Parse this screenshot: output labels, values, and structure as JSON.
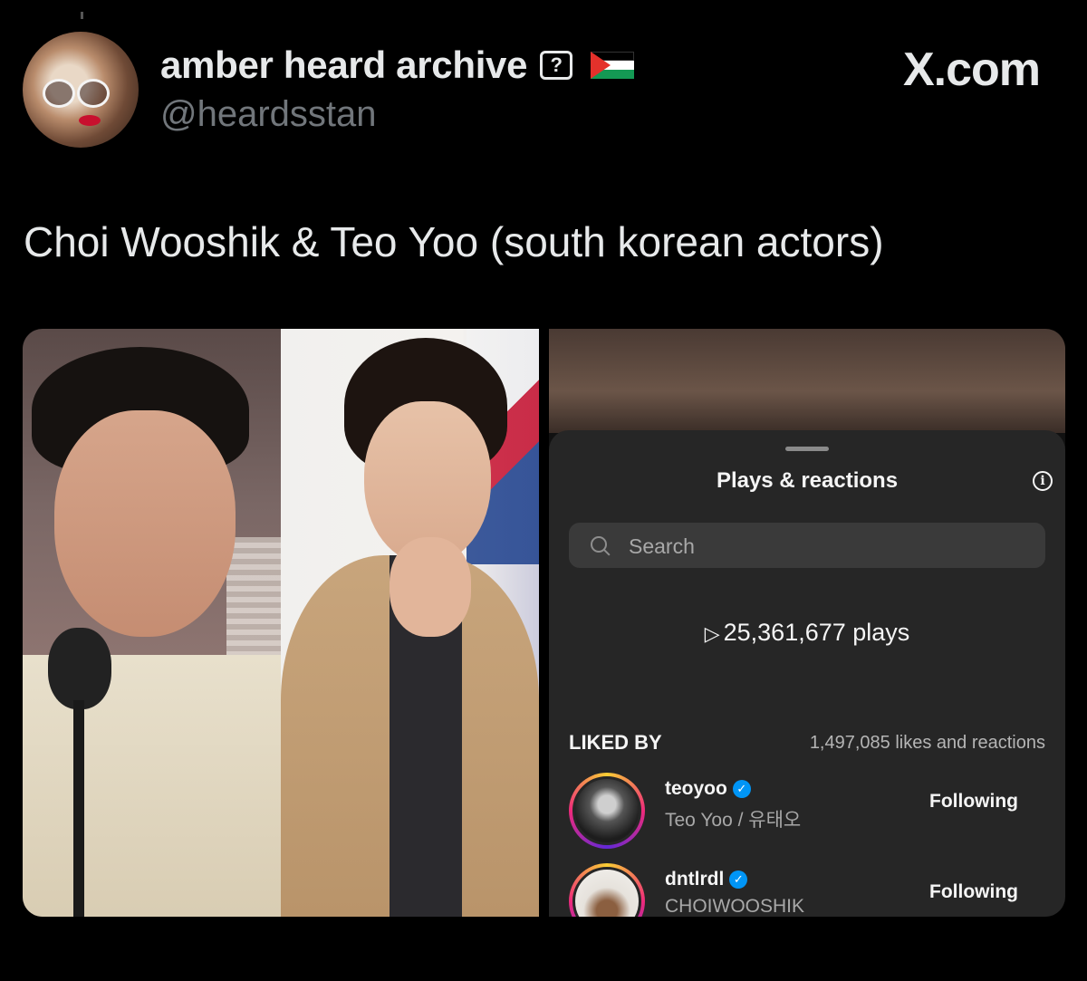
{
  "tweet": {
    "display_name": "amber heard archive",
    "badge": "?",
    "handle": "@heardsstan",
    "source": "X.com",
    "text": "Choi Wooshik & Teo Yoo (south korean actors)"
  },
  "screenshot": {
    "title": "Plays & reactions",
    "info_icon": "i",
    "search_placeholder": "Search",
    "plays": "25,361,677 plays",
    "liked_by_label": "LIKED BY",
    "likes_count": "1,497,085 likes and reactions",
    "users": [
      {
        "handle": "teoyoo",
        "name": "Teo Yoo / 유태오",
        "action": "Following"
      },
      {
        "handle": "dntlrdl",
        "name": "CHOIWOOSHIK",
        "action": "Following"
      }
    ]
  },
  "icons": {
    "verified": "✓",
    "play": "▷"
  }
}
